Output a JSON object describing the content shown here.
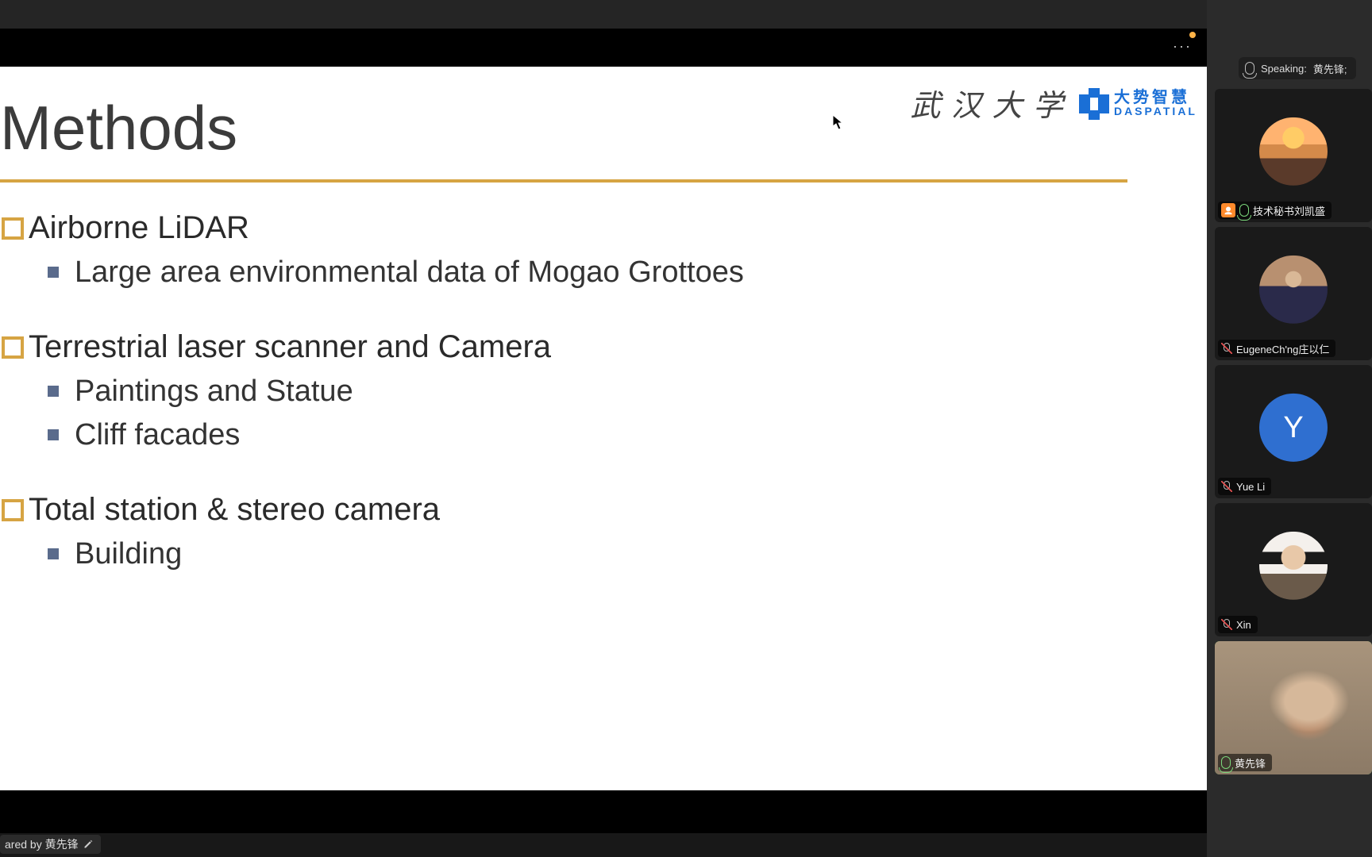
{
  "presentation": {
    "more_label": "···",
    "slide": {
      "title": "Methods",
      "logo_whu": "武 汉 大 学",
      "logo_brand_cn": "大势智慧",
      "logo_brand_en": "DASPATIAL",
      "groups": [
        {
          "l1": "Airborne LiDAR",
          "l2": [
            "Large area environmental data of Mogao Grottoes"
          ]
        },
        {
          "l1": "Terrestrial laser scanner and Camera",
          "l2": [
            "Paintings and Statue",
            "Cliff facades"
          ]
        },
        {
          "l1": "Total station & stereo camera",
          "l2": [
            "Building"
          ]
        }
      ]
    },
    "shared_by": "ared by 黄先锋"
  },
  "side": {
    "speaking_prefix": "Speaking:",
    "speaking_name": "黄先锋;",
    "participants": [
      {
        "name": "技术秘书刘凯盛",
        "host": true,
        "muted": false,
        "avatar": "scenic",
        "letter": ""
      },
      {
        "name": "EugeneCh'ng庄以仁",
        "host": false,
        "muted": true,
        "avatar": "photo1",
        "letter": ""
      },
      {
        "name": "Yue Li",
        "host": false,
        "muted": true,
        "avatar": "letter",
        "letter": "Y",
        "color": "#2f6fd0"
      },
      {
        "name": "Xin",
        "host": false,
        "muted": true,
        "avatar": "photo2",
        "letter": ""
      },
      {
        "name": "黄先锋",
        "host": false,
        "muted": false,
        "avatar": "video",
        "letter": "",
        "speaking": true
      }
    ]
  }
}
